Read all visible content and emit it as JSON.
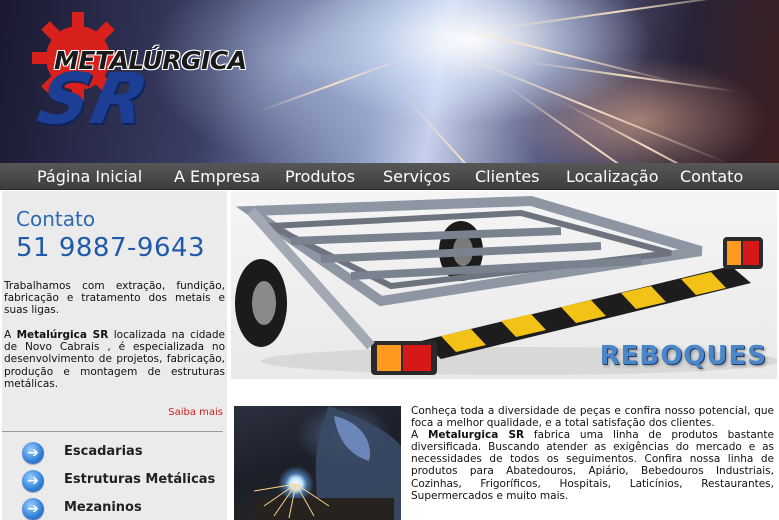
{
  "header": {
    "logo_title": "METALÚRGICA",
    "logo_sr": "SR"
  },
  "nav": {
    "items": [
      {
        "label": "Página Inicial"
      },
      {
        "label": "A Empresa"
      },
      {
        "label": "Produtos"
      },
      {
        "label": "Serviços"
      },
      {
        "label": "Clientes"
      },
      {
        "label": "Localização"
      },
      {
        "label": "Contato"
      }
    ]
  },
  "sidebar": {
    "contato_label": "Contato",
    "phone": "51 9887-9643",
    "intro": "Trabalhamos com extração, fundição, fabricação e tratamento dos metais e suas ligas.",
    "about_prefix": "A ",
    "about_brand": "Metalúrgica SR",
    "about_rest": " localizada na cidade de Novo Cabrais , é especializada no desenvolvimento de projetos, fabricação, produção e montagem de estruturas metálicas.",
    "saiba_mais": "Saiba mais",
    "links": [
      {
        "label": "Escadarias"
      },
      {
        "label": "Estruturas Metálicas"
      },
      {
        "label": "Mezaninos"
      }
    ]
  },
  "hero": {
    "caption": "REBOQUES"
  },
  "main": {
    "paragraph1": "Conheça toda a diversidade de peças e confira nosso potencial, que foca a melhor qualidade, e a total satisfação dos clientes.",
    "paragraph2_prefix": "A ",
    "paragraph2_brand": "Metalurgica SR",
    "paragraph2_rest": " fabrica uma linha de produtos bastante diversificada. Buscando atender as exigências do mercado e as necessidades de todos os seguimentos. Confira nossa linha de produtos para Abatedouros, Apiário, Bebedouros Industriais, Cozinhas, Frigoríficos, Hospitais, Laticínios, Restaurantes, Supermercados e muito mais."
  },
  "colors": {
    "nav_bg": "#4a4a4a",
    "accent_blue": "#1e5aa8",
    "logo_blue": "#1c3f95",
    "logo_gear_red": "#d8201c",
    "saiba_red": "#d21c1c",
    "sidebar_bg": "#ebebeb"
  },
  "icons": {
    "logo_gear": "gear-icon",
    "side_link_arrow": "arrow-right-circle-icon"
  }
}
